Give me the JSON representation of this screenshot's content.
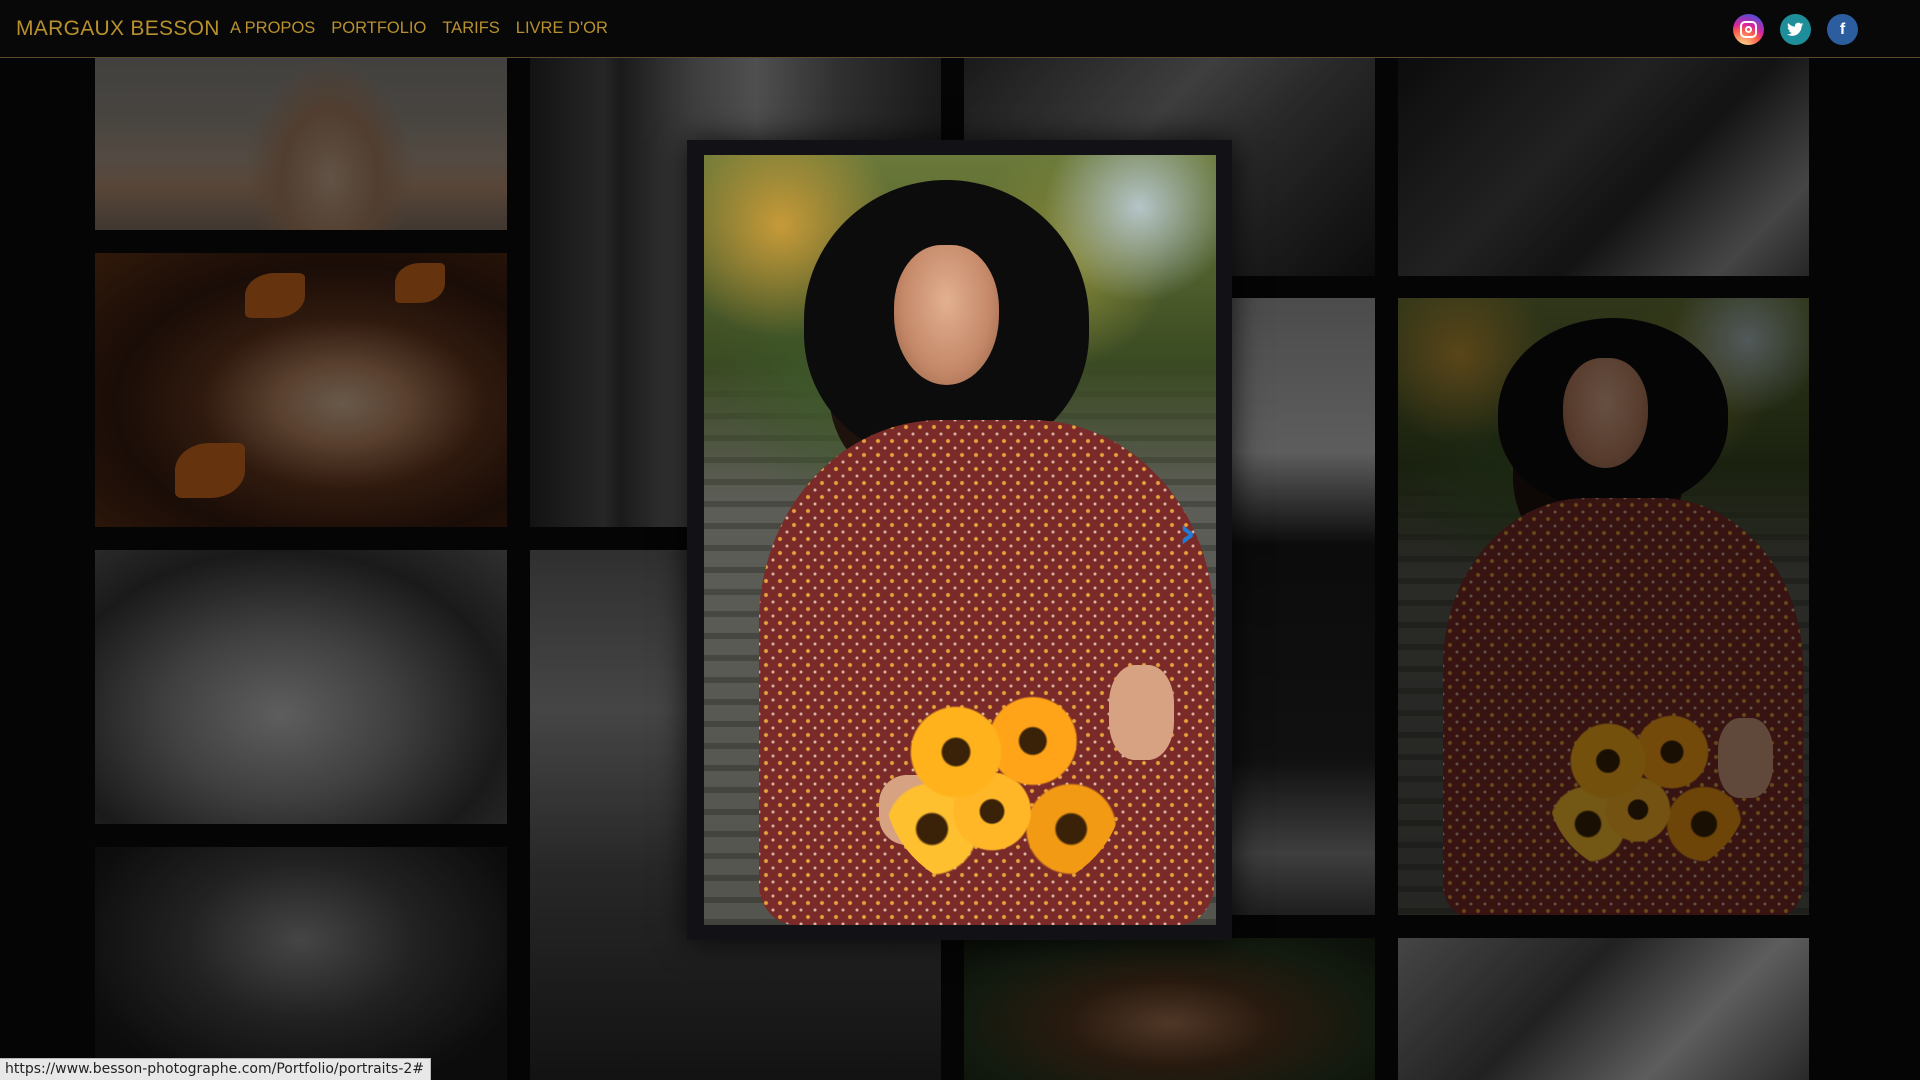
{
  "brand": {
    "name": "MARGAUX BESSON"
  },
  "nav": {
    "items": [
      {
        "label": "A PROPOS"
      },
      {
        "label": "PORTFOLIO"
      },
      {
        "label": "TARIFS"
      },
      {
        "label": "LIVRE D'OR"
      }
    ]
  },
  "social": {
    "instagram": {
      "icon": "instagram-icon",
      "color": "#d6249f"
    },
    "twitter": {
      "icon": "twitter-icon",
      "color": "#1e8f9a"
    },
    "facebook": {
      "icon": "facebook-icon",
      "glyph": "f",
      "color": "#2c5d9e"
    }
  },
  "lightbox": {
    "next_icon": "chevron-right-icon",
    "next_glyph": "›",
    "accent": "#1f7bd6"
  },
  "status_bar": {
    "url": "https://www.besson-photographe.com/Portfolio/portraits-2#"
  },
  "colors": {
    "brand_gold": "#b8902e",
    "background": "#050505"
  }
}
